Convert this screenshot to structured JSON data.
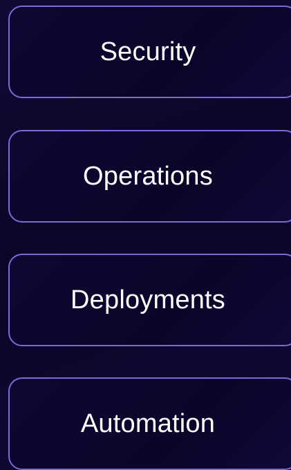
{
  "nav": {
    "items": [
      {
        "label": "Security"
      },
      {
        "label": "Operations"
      },
      {
        "label": "Deployments"
      },
      {
        "label": "Automation"
      }
    ]
  },
  "colors": {
    "background": "#0c0628",
    "card_border": "#7b6bd9",
    "text": "#ffffff"
  }
}
